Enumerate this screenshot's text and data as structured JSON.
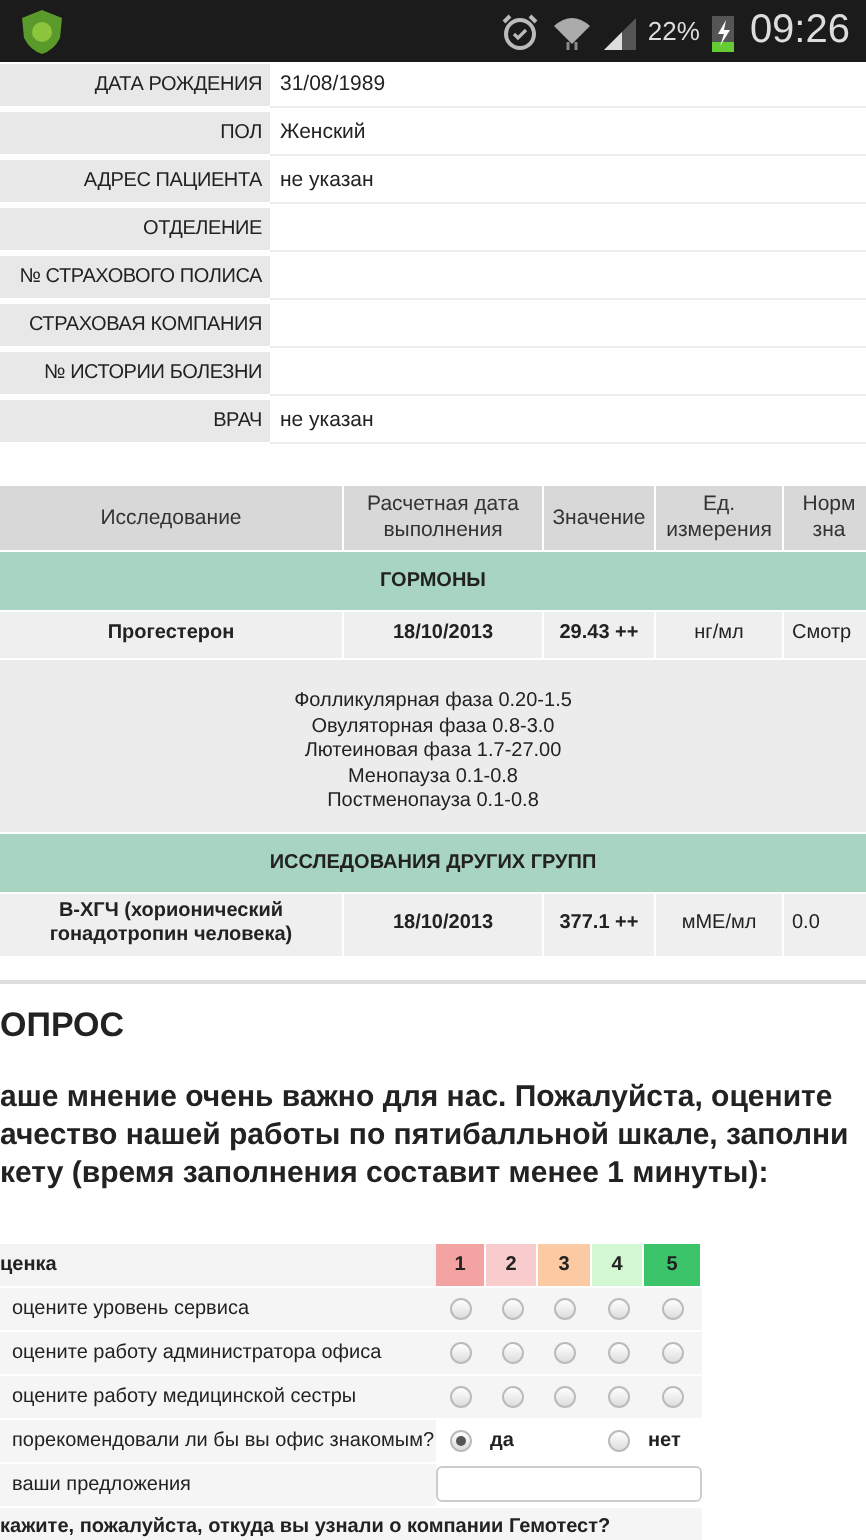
{
  "status_bar": {
    "battery": "22%",
    "time": "09:26"
  },
  "patient": [
    {
      "label": "ДАТА РОЖДЕНИЯ",
      "value": "31/08/1989"
    },
    {
      "label": "ПОЛ",
      "value": "Женский"
    },
    {
      "label": "АДРЕС ПАЦИЕНТА",
      "value": "не указан"
    },
    {
      "label": "ОТДЕЛЕНИЕ"
    },
    {
      "label": "№ СТРАХОВОГО ПОЛИСА"
    },
    {
      "label": "СТРАХОВАЯ КОМПАНИЯ"
    },
    {
      "label": "№ ИСТОРИИ БОЛЕЗНИ"
    },
    {
      "label": "ВРАЧ",
      "value": "не указан"
    }
  ],
  "results": {
    "columns": [
      "Исследование",
      "Расчетная дата выполнения",
      "Значение",
      "Ед. измерения",
      "Норм зна"
    ],
    "rows": [
      {
        "kind": "group",
        "title": "ГОРМОНЫ"
      },
      {
        "kind": "test",
        "cells": [
          "Прогестерон",
          "18/10/2013",
          "29.43 ++",
          "нг/мл",
          "Смотр"
        ]
      },
      {
        "kind": "norms",
        "lines": [
          "Фолликулярная фаза 0.20-1.5",
          "Овуляторная фаза 0.8-3.0",
          "Лютеиновая фаза 1.7-27.00",
          "Менопауза 0.1-0.8",
          "Постменопауза 0.1-0.8"
        ]
      },
      {
        "kind": "group",
        "title": "ИССЛЕДОВАНИЯ ДРУГИХ ГРУПП"
      },
      {
        "kind": "test",
        "cells": [
          "В-ХГЧ (хорионический гонадотропин человека)",
          "18/10/2013",
          "377.1 ++",
          "мМЕ/мл",
          "0.0"
        ]
      }
    ]
  },
  "survey": {
    "title": "ОПРОС",
    "intro": "аше мнение очень важно для нас. Пожалуйста, оцените ачество нашей работы по пятибалльной шкале, заполни кету (время заполнения составит менее 1 минуты):",
    "header": "ценка",
    "scores": [
      {
        "label": "1",
        "color": "#f4a3a3"
      },
      {
        "label": "2",
        "color": "#f8cccc"
      },
      {
        "label": "3",
        "color": "#fbcaa2"
      },
      {
        "label": "4",
        "color": "#d3f6d3"
      },
      {
        "label": "5",
        "color": "#3cc46b"
      }
    ],
    "questions": [
      {
        "kind": "rating",
        "label": "оцените уровень сервиса",
        "options": [
          {
            "selected": false
          },
          {
            "selected": false
          },
          {
            "selected": false
          },
          {
            "selected": false
          },
          {
            "selected": false
          }
        ]
      },
      {
        "kind": "rating",
        "label": "оцените работу администратора офиса",
        "options": [
          {
            "selected": false
          },
          {
            "selected": false
          },
          {
            "selected": false
          },
          {
            "selected": false
          },
          {
            "selected": false
          }
        ]
      },
      {
        "kind": "rating",
        "label": "оцените работу медицинской сестры",
        "options": [
          {
            "selected": false
          },
          {
            "selected": false
          },
          {
            "selected": false
          },
          {
            "selected": false
          },
          {
            "selected": false
          }
        ]
      },
      {
        "kind": "choice",
        "label": "порекомендовали ли бы вы офис знакомым?",
        "options": [
          {
            "label": "да",
            "selected": true
          },
          {
            "label": "нет",
            "selected": false
          }
        ]
      },
      {
        "kind": "text",
        "label": "ваши предложения"
      }
    ],
    "footer_question": "кажите, пожалуйста, откуда вы узнали о компании Гемотест?"
  }
}
